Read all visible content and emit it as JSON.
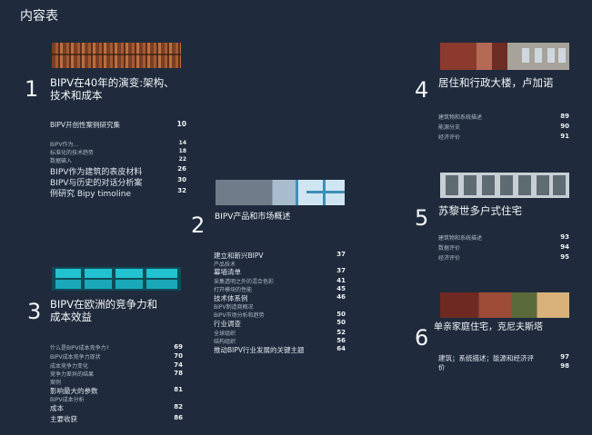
{
  "page_title": "内容表",
  "chapters": [
    {
      "number": "1",
      "title_lines": [
        "BIPV在40年的演变:架构、",
        "技术和成本"
      ],
      "entries": [
        {
          "label": "BIPV开创性案例研究集",
          "page": "10"
        },
        {
          "label": "BIPV作为...",
          "page": "14"
        },
        {
          "label": "标准化的技术趋势",
          "page": "18"
        },
        {
          "label": "数据输入",
          "page": "22"
        },
        {
          "label": "BIPV作为建筑的表皮材料",
          "page": "26"
        },
        {
          "label": "BIPV与历史的对话分析案",
          "page": "30"
        },
        {
          "label": "例研究 Bipy timoline",
          "page": "32"
        }
      ]
    },
    {
      "number": "2",
      "title_lines": [
        "BIPV产品和市场概述"
      ],
      "entries": [
        {
          "label": "建立和新兴BIPV",
          "page": "37"
        },
        {
          "label": "产品技术",
          "page": ""
        },
        {
          "label": "幕墙清单",
          "page": "37"
        },
        {
          "label": "采集透明之外的混合色彩",
          "page": "41"
        },
        {
          "label": "打开模块的性能",
          "page": "45"
        },
        {
          "label": "技术体系例",
          "page": "46"
        },
        {
          "label": "BIPV制造商概况",
          "page": ""
        },
        {
          "label": "BIPV市场分析和趋势",
          "page": "50"
        },
        {
          "label": "行业调查",
          "page": "50"
        },
        {
          "label": "全球组织",
          "page": "52"
        },
        {
          "label": "结构组织",
          "page": "56"
        },
        {
          "label": "推动BIPV行业发展的关键主题",
          "page": "64"
        }
      ]
    },
    {
      "number": "3",
      "title_lines": [
        "BIPV在欧洲的竞争力和",
        "成本效益"
      ],
      "entries": [
        {
          "label": "什么是BIPV成本竞争力?",
          "page": "69"
        },
        {
          "label": "BIPV成本竞争力现状",
          "page": "70"
        },
        {
          "label": "成本竞争力变化",
          "page": "74"
        },
        {
          "label": "竞争力差异的结果",
          "page": "78"
        },
        {
          "label": "案例",
          "page": ""
        },
        {
          "label": "影响最大的参数",
          "page": "81"
        },
        {
          "label": "BIPV成本分析",
          "page": ""
        },
        {
          "label": "成本",
          "page": "82"
        },
        {
          "label": "主要收获",
          "page": "86"
        }
      ]
    },
    {
      "number": "4",
      "title_lines": [
        "居住和行政大楼，卢加诺"
      ],
      "entries": [
        {
          "label": "建筑物和系统描述",
          "page": "89"
        },
        {
          "label": "能源分支",
          "page": "90"
        },
        {
          "label": "经济评价",
          "page": "91"
        }
      ]
    },
    {
      "number": "5",
      "title_lines": [
        "苏黎世多户式住宅"
      ],
      "entries": [
        {
          "label": "建筑物和系统描述",
          "page": "93"
        },
        {
          "label": "数据评价",
          "page": "94"
        },
        {
          "label": "经济评价",
          "page": "95"
        }
      ]
    },
    {
      "number": "6",
      "title_lines": [
        "单亲家庭住宅，克尼夫斯塔"
      ],
      "entries": [
        {
          "label": "建筑；系统描述；能源和经济评",
          "page": "97"
        },
        {
          "label": "价",
          "page": "98"
        }
      ]
    }
  ]
}
